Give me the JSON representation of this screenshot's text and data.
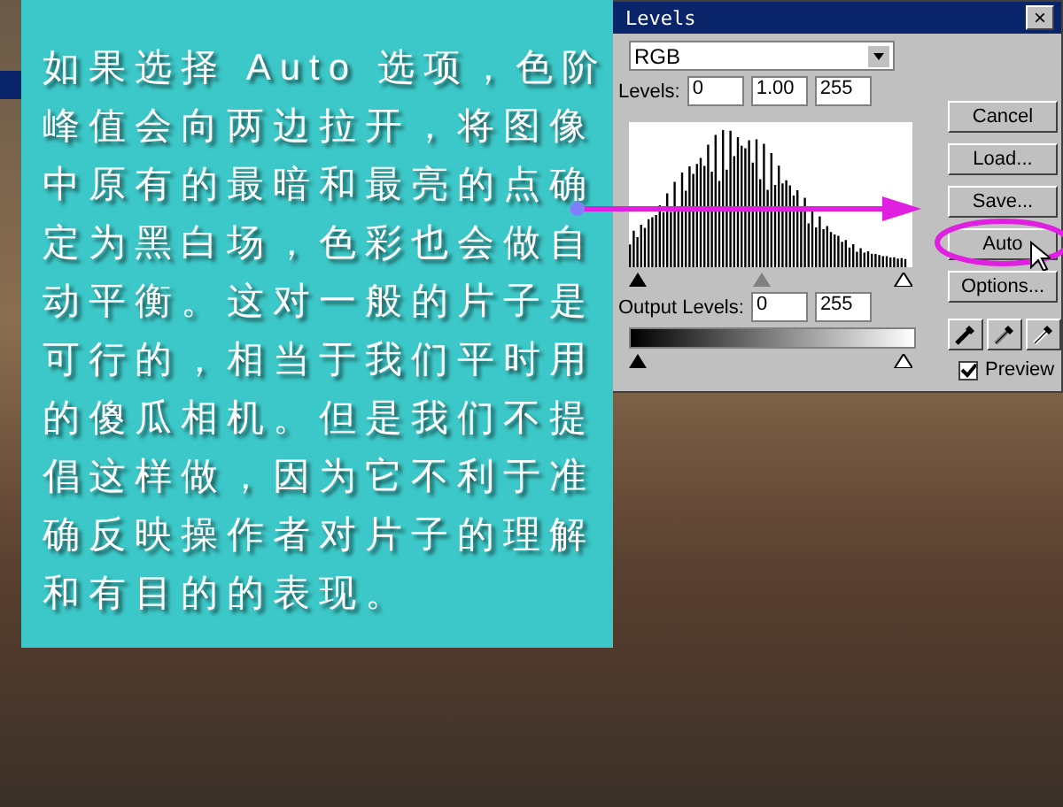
{
  "levels_dialog": {
    "title": "Levels",
    "close": "×",
    "channel": "RGB",
    "input_label": "Levels:",
    "input_levels": [
      "0",
      "1.00",
      "255"
    ],
    "output_label": "Output Levels:",
    "output_levels": [
      "0",
      "255"
    ],
    "buttons": [
      {
        "label": "Cancel",
        "circled": false
      },
      {
        "label": "Load...",
        "circled": false
      },
      {
        "label": "Save...",
        "circled": false
      },
      {
        "label": "Auto",
        "circled": true
      },
      {
        "label": "Options...",
        "circled": false
      }
    ],
    "preview": {
      "label": "Preview",
      "checked": true
    }
  },
  "caption": {
    "text": "如果选择 Auto 选项，色阶峰值会向两边拉开，将图像中原有的最暗和最亮的点确定为黑白场，色彩也会做自动平衡。这对一般的片子是可行的，相当于我们平时用的傻瓜相机。但是我们不提倡这样做，因为它不利于准确反映操作者对片子的理解和有目的的表现。"
  }
}
